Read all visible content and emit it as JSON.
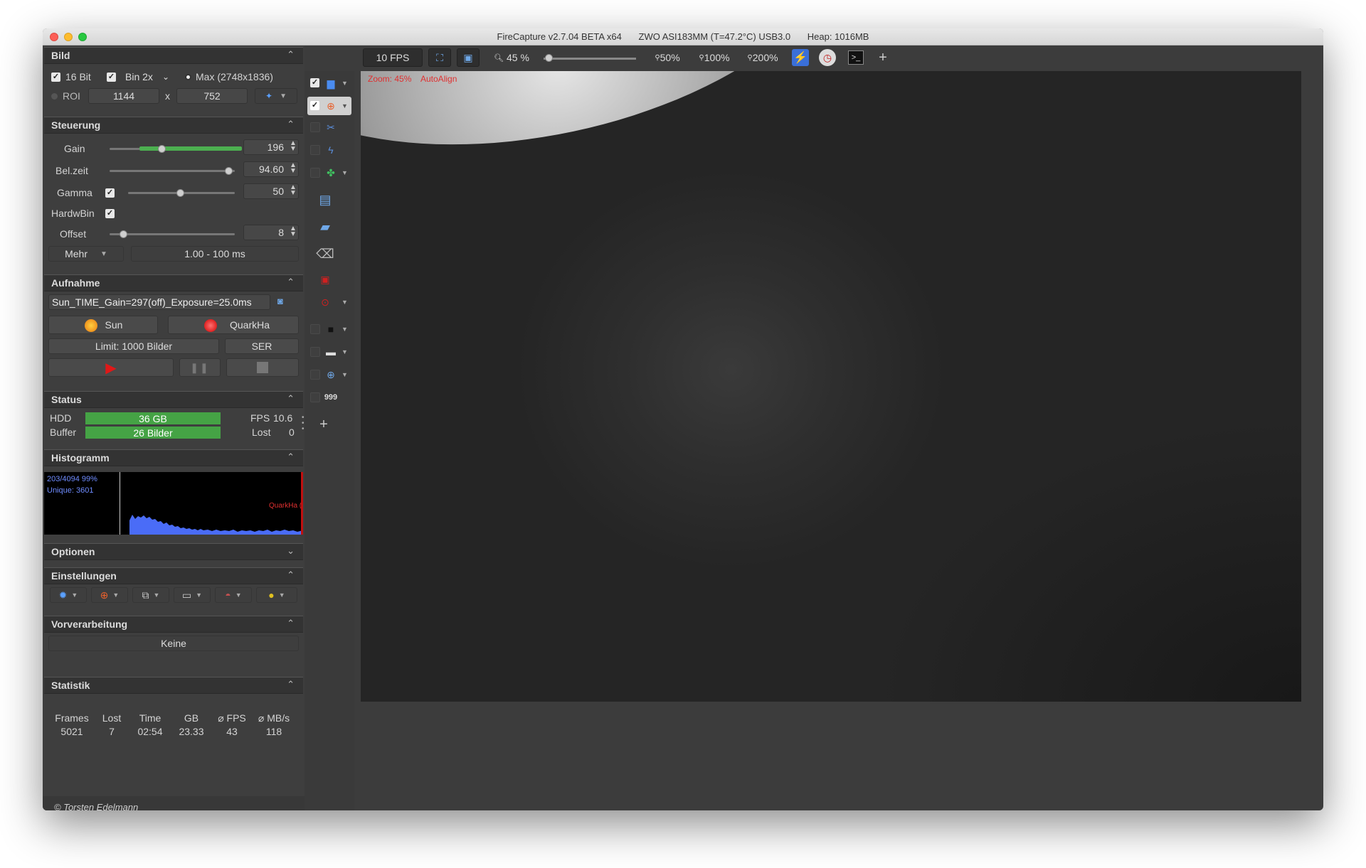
{
  "window": {
    "app_title": "FireCapture v2.7.04 BETA x64",
    "camera": "ZWO ASI183MM (T=47.2°C) USB3.0",
    "heap": "Heap: 1016MB"
  },
  "bild": {
    "header": "Bild",
    "bit16_label": "16 Bit",
    "bin_value": "Bin 2x",
    "max_label": "Max (2748x1836)",
    "roi_label": "ROI",
    "roi_width": "1144",
    "roi_x": "x",
    "roi_height": "752"
  },
  "steuerung": {
    "header": "Steuerung",
    "gain_label": "Gain",
    "gain_value": "196",
    "gain_level": 0.4,
    "belzeit_label": "Bel.zeit",
    "belzeit_value": "94.60",
    "gamma_label": "Gamma",
    "gamma_value": "50",
    "hardwbin_label": "HardwBin",
    "offset_label": "Offset",
    "offset_value": "8",
    "mehr_label": "Mehr",
    "range_text": "1.00 - 100 ms"
  },
  "aufnahme": {
    "header": "Aufnahme",
    "filename": "Sun_TIME_Gain=297(off)_Exposure=25.0ms",
    "profile_sun": "Sun",
    "profile_quark": "QuarkHa",
    "limit_label": "Limit: 1000 Bilder",
    "format_label": "SER"
  },
  "status": {
    "header": "Status",
    "hdd_label": "HDD",
    "hdd_value": "36 GB",
    "fps_label": "FPS",
    "fps_value": "10.6",
    "buffer_label": "Buffer",
    "buffer_value": "26  Bilder",
    "lost_label": "Lost",
    "lost_value": "0"
  },
  "histogramm": {
    "header": "Histogramm",
    "line1": "203/4094 99%",
    "line2": "Unique: 3601",
    "profile": "QuarkHa ("
  },
  "optionen": {
    "header": "Optionen"
  },
  "einstellungen": {
    "header": "Einstellungen"
  },
  "vorverarbeitung": {
    "header": "Vorverarbeitung",
    "value": "Keine"
  },
  "statistik": {
    "header": "Statistik",
    "columns": [
      "Frames",
      "Lost",
      "Time",
      "GB",
      "⌀ FPS",
      "⌀ MB/s"
    ],
    "values": [
      "5021",
      "7",
      "02:54",
      "23.33",
      "43",
      "118"
    ]
  },
  "footer": {
    "copyright": "© Torsten Edelmann"
  },
  "toolbar": {
    "fps": "10 FPS",
    "zoom_pct": "45 %",
    "zoom50": "50%",
    "zoom100": "100%",
    "zoom200": "200%"
  },
  "viewer": {
    "zoom_label": "Zoom: 45%",
    "autoalign_label": "AutoAlign"
  },
  "colors": {
    "accent_green": "#45a345",
    "overlay_red": "#e03030",
    "histogram_blue": "#4a6cf7"
  }
}
